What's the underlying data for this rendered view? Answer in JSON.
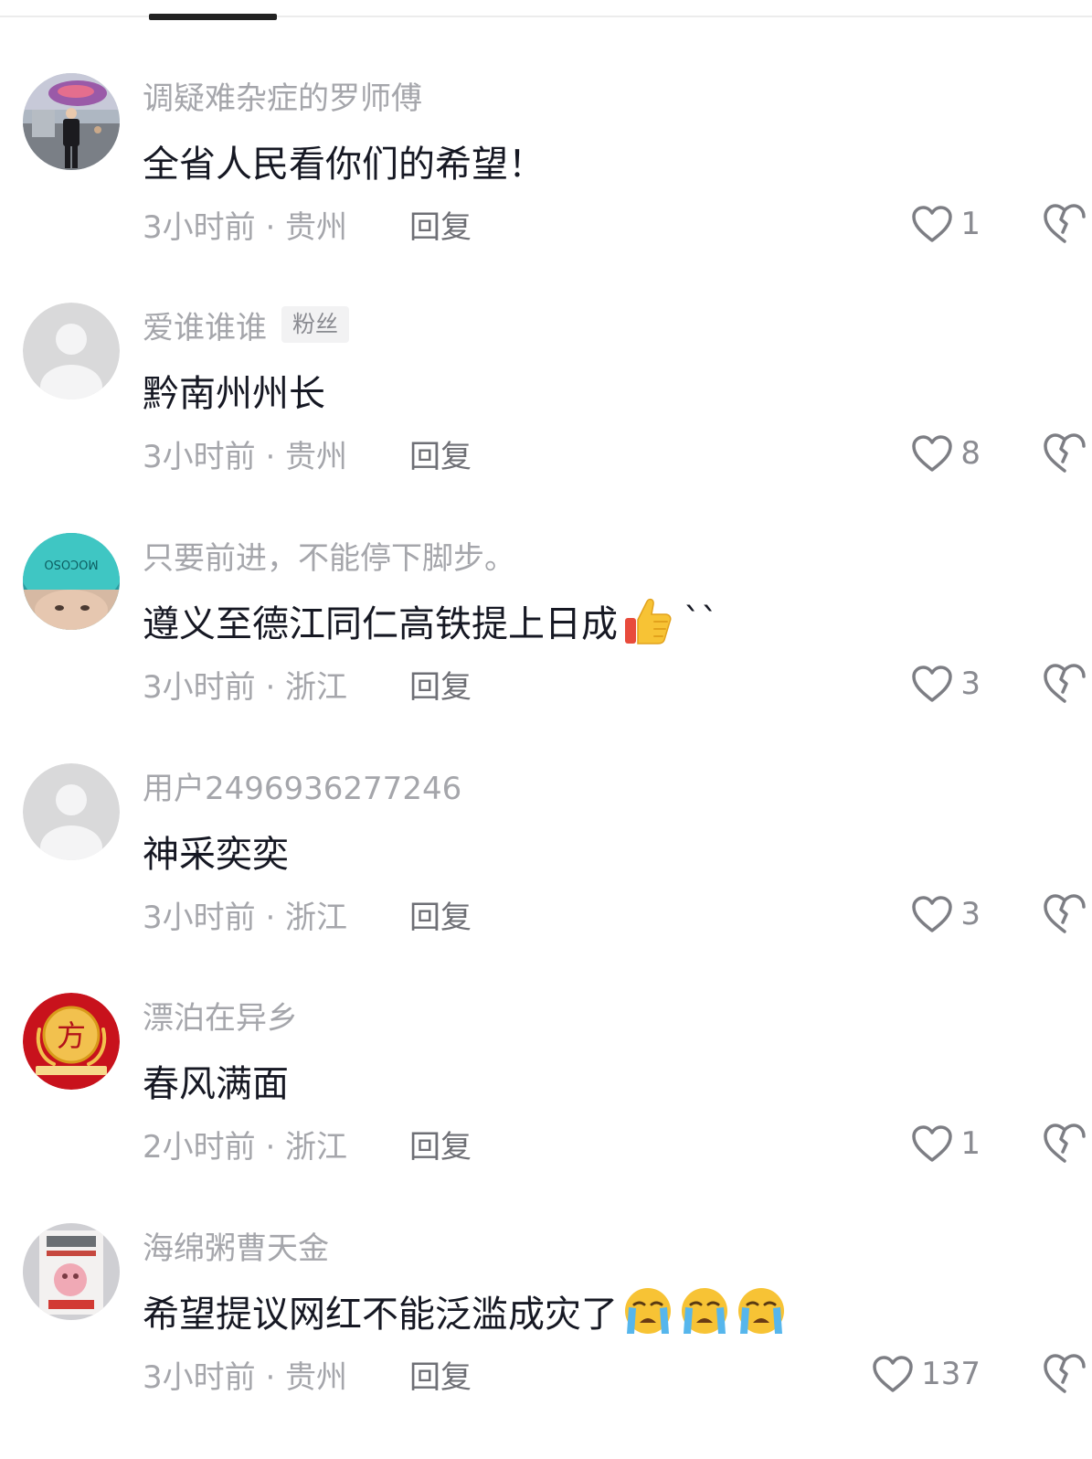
{
  "comments": [
    {
      "username": "调疑难杂症的罗师傅",
      "badge": "",
      "text": "全省人民看你们的希望！",
      "time": "3小时前 · 贵州",
      "reply_label": "回复",
      "likes": "1",
      "avatar": "photo-man-avatar"
    },
    {
      "username": "爱谁谁谁",
      "badge": "粉丝",
      "text": "黔南州州长",
      "time": "3小时前 · 贵州",
      "reply_label": "回复",
      "likes": "8",
      "avatar": "default-avatar"
    },
    {
      "username": "只要前进，不能停下脚步。",
      "badge": "",
      "text": "遵义至德江同仁高铁提上日成",
      "emoji": "thumbs-up",
      "extra": "``",
      "time": "3小时前 · 浙江",
      "reply_label": "回复",
      "likes": "3",
      "avatar": "photo-helmet-avatar"
    },
    {
      "username": "用户2496936277246",
      "badge": "",
      "text": "神采奕奕",
      "time": "3小时前 · 浙江",
      "reply_label": "回复",
      "likes": "3",
      "avatar": "default-avatar"
    },
    {
      "username": "漂泊在异乡",
      "badge": "",
      "text": "春风满面",
      "time": "2小时前 · 浙江",
      "reply_label": "回复",
      "likes": "1",
      "avatar": "red-fang-logo-avatar"
    },
    {
      "username": "海绵粥曹天金",
      "badge": "",
      "text": "希望提议网红不能泛滥成灾了",
      "emoji": "crying-x3",
      "time": "3小时前 · 贵州",
      "reply_label": "回复",
      "likes": "137",
      "avatar": "photo-product-avatar"
    }
  ],
  "colors": {
    "username": "#a5a6ab",
    "text": "#161823",
    "meta": "#a5a6ab",
    "reply": "#6e6f75"
  }
}
